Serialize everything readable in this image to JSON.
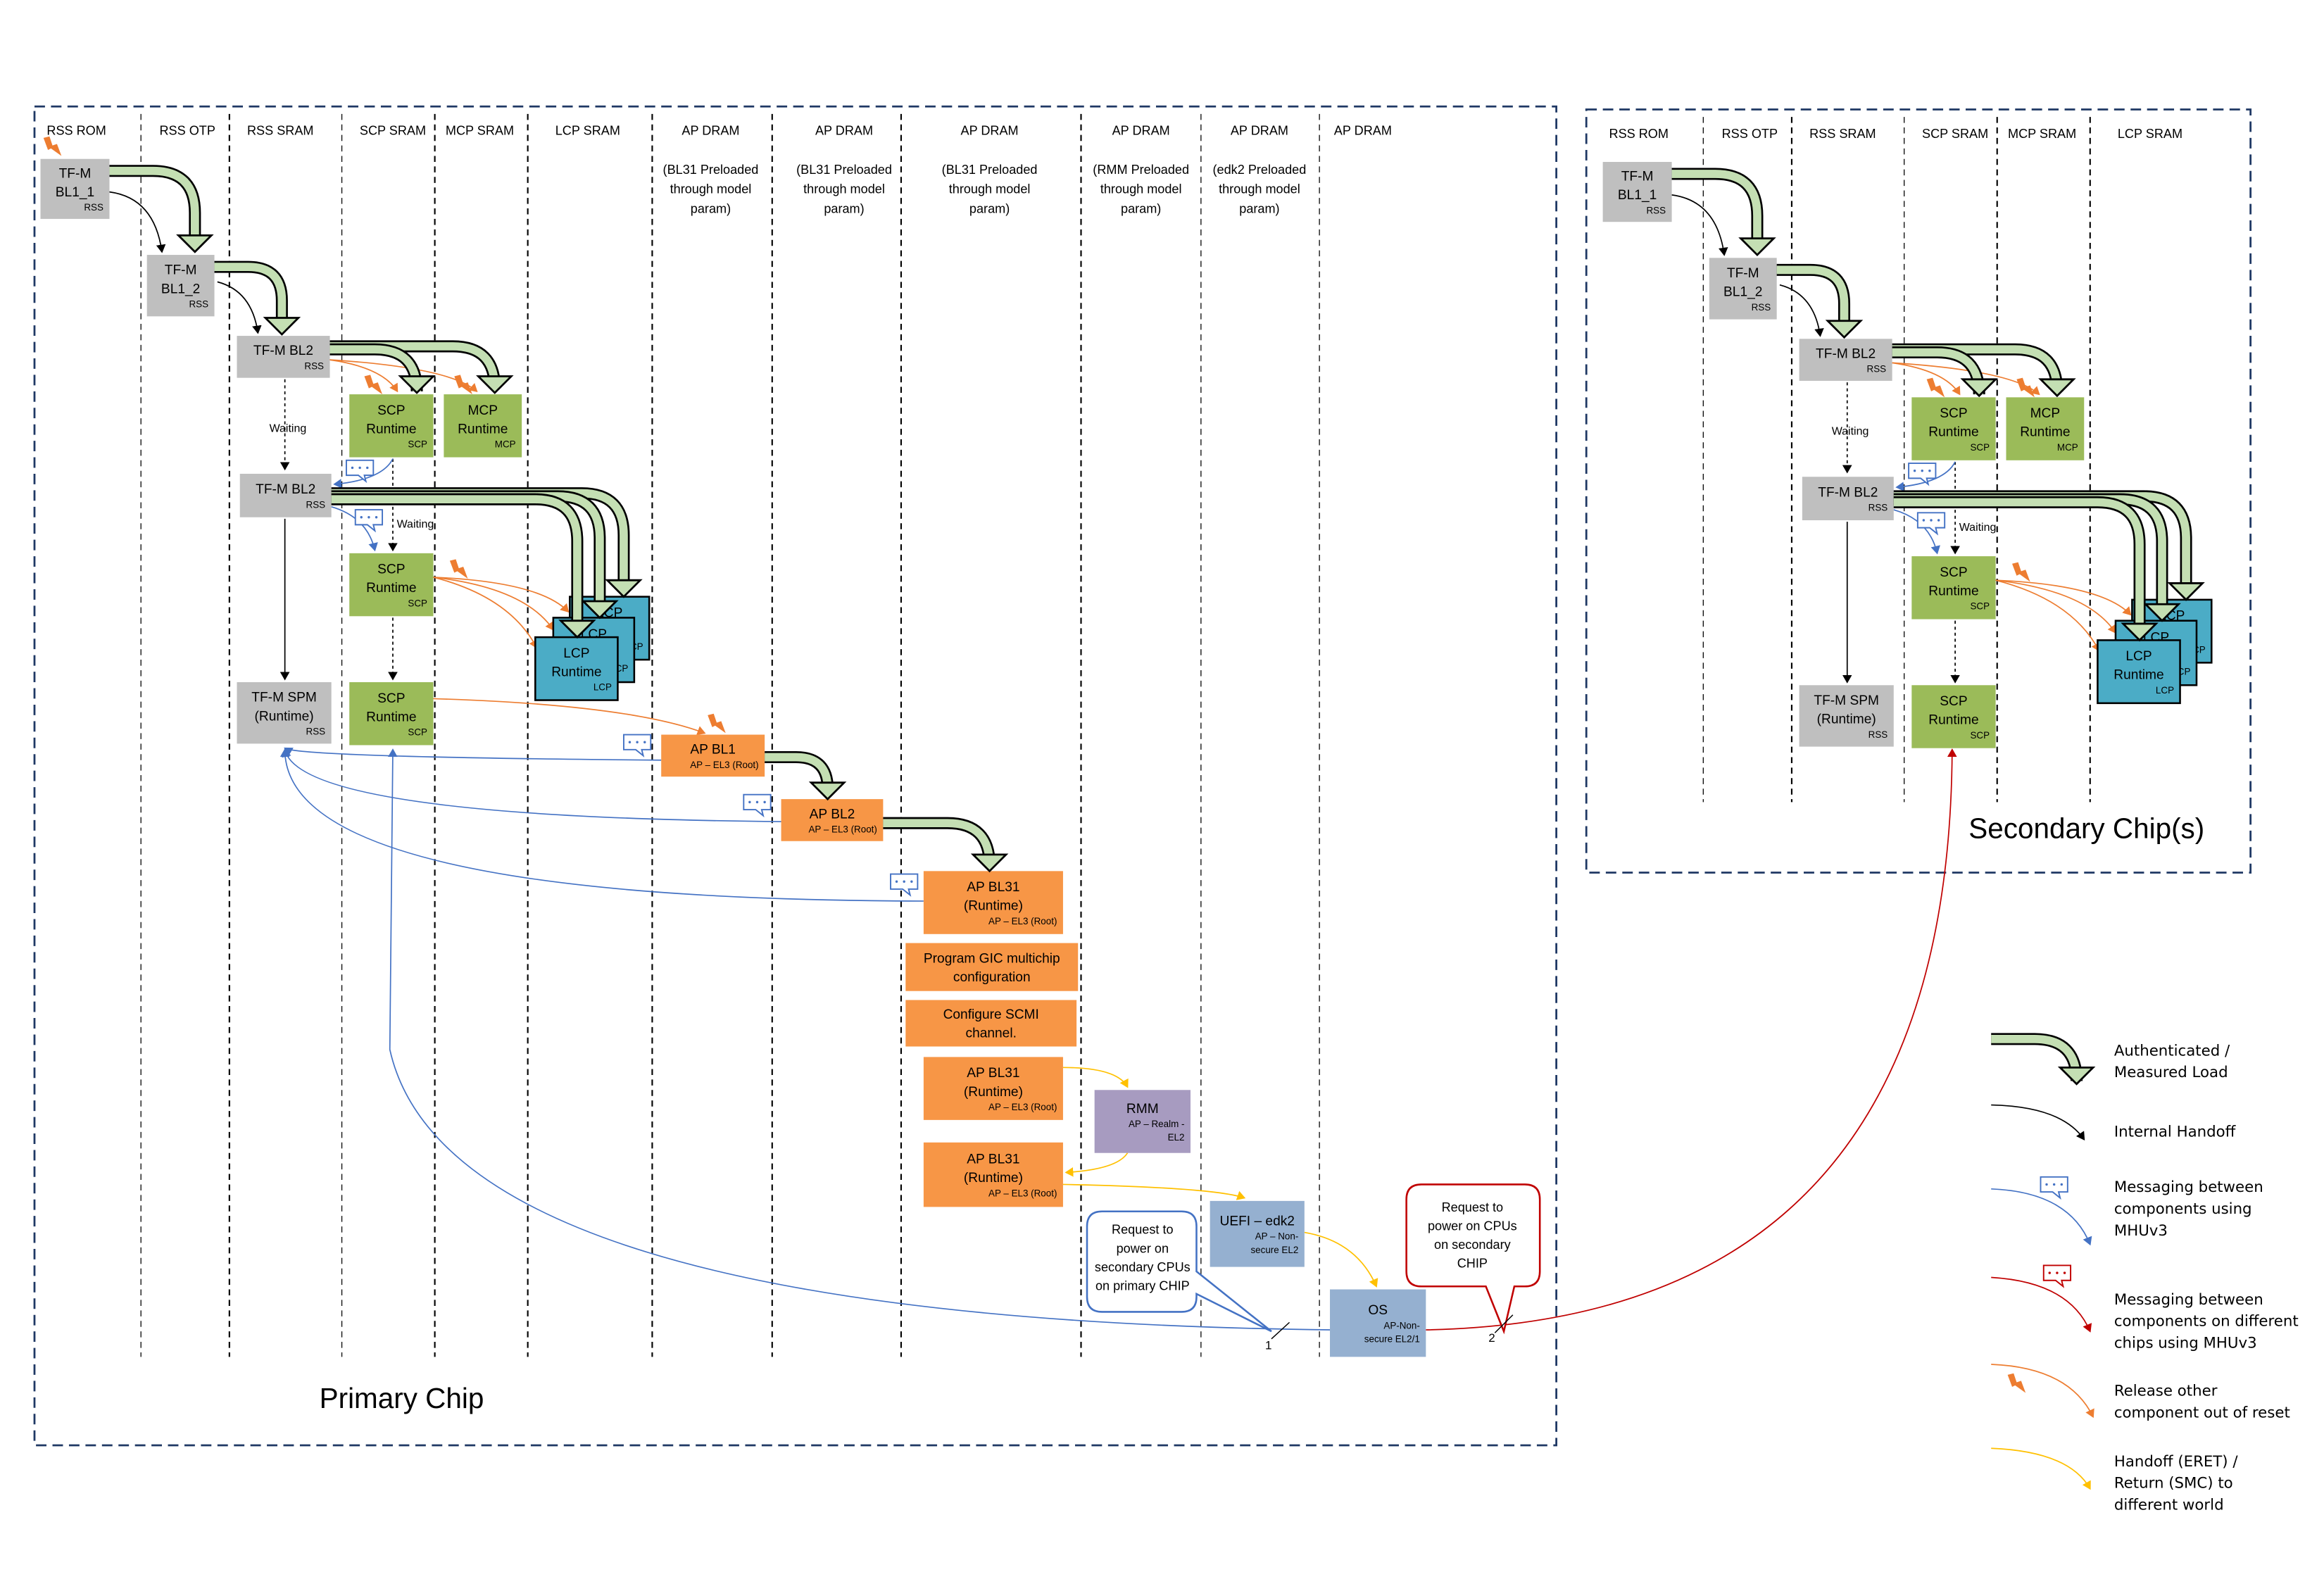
{
  "colors": {
    "rss": "#bfbfbf",
    "scp": "#9bbb59",
    "lcp": "#4bacc6",
    "ap": "#f79646",
    "rmm": "#a79bc0",
    "ns": "#95b0d0",
    "load_arrow": "#c4dfb3",
    "frame": "#1f3864",
    "mhu": "#4472c4",
    "mhu_chip": "#c00000",
    "reset": "#ed7d31",
    "eret": "#ffc000"
  },
  "primary": {
    "title": "Primary Chip",
    "lanes": [
      {
        "label": "RSS ROM"
      },
      {
        "label": "RSS OTP"
      },
      {
        "label": "RSS SRAM"
      },
      {
        "label": "SCP SRAM"
      },
      {
        "label": "MCP SRAM"
      },
      {
        "label": "LCP SRAM"
      },
      {
        "label": "AP DRAM",
        "note": [
          "(BL31 Preloaded",
          "through model",
          "param)"
        ]
      },
      {
        "label": "AP DRAM",
        "note": [
          "(BL31 Preloaded",
          "through model",
          "param)"
        ]
      },
      {
        "label": "AP DRAM",
        "note": [
          "(BL31 Preloaded",
          "through model",
          "param)"
        ]
      },
      {
        "label": "AP DRAM",
        "note": [
          "(RMM Preloaded",
          "through model",
          "param)"
        ]
      },
      {
        "label": "AP DRAM",
        "note": [
          "(edk2 Preloaded",
          "through model",
          "param)"
        ]
      },
      {
        "label": "AP DRAM"
      }
    ],
    "waiting": [
      "Waiting",
      "Waiting"
    ],
    "boxes": [
      {
        "id": "bl11",
        "lines": [
          "TF-M",
          "BL1_1"
        ],
        "sub": "RSS",
        "kind": "rss"
      },
      {
        "id": "bl12",
        "lines": [
          "TF-M",
          "BL1_2"
        ],
        "sub": "RSS",
        "kind": "rss"
      },
      {
        "id": "bl2a",
        "lines": [
          "TF-M BL2"
        ],
        "sub": "RSS",
        "kind": "rss"
      },
      {
        "id": "scp1",
        "lines": [
          "SCP",
          "Runtime"
        ],
        "sub": "SCP",
        "kind": "scp"
      },
      {
        "id": "mcp1",
        "lines": [
          "MCP",
          "Runtime"
        ],
        "sub": "MCP",
        "kind": "scp"
      },
      {
        "id": "bl2b",
        "lines": [
          "TF-M BL2"
        ],
        "sub": "RSS",
        "kind": "rss"
      },
      {
        "id": "scp2",
        "lines": [
          "SCP",
          "Runtime"
        ],
        "sub": "SCP",
        "kind": "scp"
      },
      {
        "id": "lcp3",
        "lines": [
          "LCP",
          "Runtime"
        ],
        "sub": "LCP",
        "kind": "lcp"
      },
      {
        "id": "lcp2",
        "lines": [
          "LCP",
          "Runtime"
        ],
        "sub": "LCP",
        "kind": "lcp"
      },
      {
        "id": "lcp1",
        "lines": [
          "LCP",
          "Runtime"
        ],
        "sub": "LCP",
        "kind": "lcp"
      },
      {
        "id": "spm",
        "lines": [
          "TF-M SPM",
          "(Runtime)"
        ],
        "sub": "RSS",
        "kind": "rss"
      },
      {
        "id": "scp3",
        "lines": [
          "SCP",
          "Runtime"
        ],
        "sub": "SCP",
        "kind": "scp"
      },
      {
        "id": "apbl1",
        "lines": [
          "AP BL1"
        ],
        "sub": "AP – EL3 (Root)",
        "kind": "ap"
      },
      {
        "id": "apbl2",
        "lines": [
          "AP BL2"
        ],
        "sub": "AP – EL3 (Root)",
        "kind": "ap"
      },
      {
        "id": "bl31a",
        "lines": [
          "AP BL31",
          "(Runtime)"
        ],
        "sub": "AP – EL3 (Root)",
        "kind": "ap"
      },
      {
        "id": "gic",
        "lines": [
          "Program GIC multichip",
          "configuration"
        ],
        "kind": "ap"
      },
      {
        "id": "scmi",
        "lines": [
          "Configure SCMI",
          "channel."
        ],
        "kind": "ap"
      },
      {
        "id": "bl31b",
        "lines": [
          "AP BL31",
          "(Runtime)"
        ],
        "sub": "AP – EL3 (Root)",
        "kind": "ap"
      },
      {
        "id": "rmm",
        "lines": [
          "RMM"
        ],
        "sub": [
          "AP – Realm -",
          "EL2"
        ],
        "kind": "rmm"
      },
      {
        "id": "bl31c",
        "lines": [
          "AP BL31",
          "(Runtime)"
        ],
        "sub": "AP – EL3 (Root)",
        "kind": "ap"
      },
      {
        "id": "uefi",
        "lines": [
          "UEFI – edk2"
        ],
        "sub": [
          "AP – Non-",
          "secure EL2"
        ],
        "kind": "ns"
      },
      {
        "id": "os",
        "lines": [
          "OS"
        ],
        "sub": [
          "AP-Non-",
          "secure EL2/1"
        ],
        "kind": "ns"
      }
    ],
    "callouts": [
      {
        "id": "primary-cpus",
        "text": [
          "Request to",
          "power on",
          "secondary CPUs",
          "on primary CHIP"
        ],
        "marker": "1"
      },
      {
        "id": "secondary-cpus",
        "text": [
          "Request to",
          "power on CPUs",
          "on secondary",
          "CHIP"
        ],
        "marker": "2"
      }
    ]
  },
  "secondary": {
    "title": "Secondary Chip(s)",
    "lanes": [
      {
        "label": "RSS ROM"
      },
      {
        "label": "RSS OTP"
      },
      {
        "label": "RSS SRAM"
      },
      {
        "label": "SCP SRAM"
      },
      {
        "label": "MCP SRAM"
      },
      {
        "label": "LCP SRAM"
      }
    ],
    "waiting": [
      "Waiting",
      "Waiting"
    ],
    "boxes": [
      {
        "id": "bl11",
        "lines": [
          "TF-M",
          "BL1_1"
        ],
        "sub": "RSS",
        "kind": "rss"
      },
      {
        "id": "bl12",
        "lines": [
          "TF-M",
          "BL1_2"
        ],
        "sub": "RSS",
        "kind": "rss"
      },
      {
        "id": "bl2a",
        "lines": [
          "TF-M BL2"
        ],
        "sub": "RSS",
        "kind": "rss"
      },
      {
        "id": "scp1",
        "lines": [
          "SCP",
          "Runtime"
        ],
        "sub": "SCP",
        "kind": "scp"
      },
      {
        "id": "mcp1",
        "lines": [
          "MCP",
          "Runtime"
        ],
        "sub": "MCP",
        "kind": "scp"
      },
      {
        "id": "bl2b",
        "lines": [
          "TF-M BL2"
        ],
        "sub": "RSS",
        "kind": "rss"
      },
      {
        "id": "scp2",
        "lines": [
          "SCP",
          "Runtime"
        ],
        "sub": "SCP",
        "kind": "scp"
      },
      {
        "id": "lcp3",
        "lines": [
          "LCP",
          "Runtime"
        ],
        "sub": "LCP",
        "kind": "lcp"
      },
      {
        "id": "lcp2",
        "lines": [
          "LCP",
          "Runtime"
        ],
        "sub": "LCP",
        "kind": "lcp"
      },
      {
        "id": "lcp1",
        "lines": [
          "LCP",
          "Runtime"
        ],
        "sub": "LCP",
        "kind": "lcp"
      },
      {
        "id": "spm",
        "lines": [
          "TF-M SPM",
          "(Runtime)"
        ],
        "sub": "RSS",
        "kind": "rss"
      },
      {
        "id": "scp3",
        "lines": [
          "SCP",
          "Runtime"
        ],
        "sub": "SCP",
        "kind": "scp"
      }
    ]
  },
  "legend": [
    {
      "id": "load",
      "text": [
        "Authenticated /",
        "Measured Load"
      ]
    },
    {
      "id": "handoff",
      "text": [
        "Internal Handoff"
      ]
    },
    {
      "id": "mhu",
      "text": [
        "Messaging between",
        "components using",
        "MHUv3"
      ]
    },
    {
      "id": "mhu-chip",
      "text": [
        "Messaging between",
        "components on different",
        "chips using MHUv3"
      ]
    },
    {
      "id": "reset",
      "text": [
        "Release other",
        "component out of reset"
      ]
    },
    {
      "id": "eret",
      "text": [
        "Handoff (ERET) /",
        "Return (SMC) to",
        "different world"
      ]
    }
  ]
}
